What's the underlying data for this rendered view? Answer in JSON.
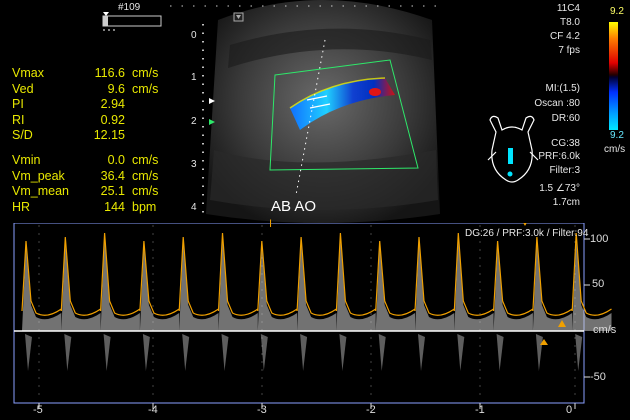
{
  "frame": {
    "number": "#109"
  },
  "settings": {
    "lines": [
      "11C4",
      "T8.0",
      "CF 4.2",
      "7 fps"
    ],
    "mi": "MI:(1.5)",
    "oscan": "Oscan :80",
    "dr": "DR:60",
    "cg": "CG:38",
    "prf": "PRF:6.0k",
    "filter": "Filter:3",
    "angle": "1.5  ∠73°",
    "depth": "1.7cm"
  },
  "color_bar": {
    "top_label": "9.2",
    "bottom_label": "9.2",
    "unit": "cm/s",
    "colors_top": "#ffff00",
    "colors_mid": "#e00000",
    "colors_blue": "#0040ff",
    "colors_bottom": "#00c8ff"
  },
  "measurements": [
    {
      "label": "Vmax",
      "value": "116.6",
      "unit": "cm/s"
    },
    {
      "label": "Ved",
      "value": "9.6",
      "unit": "cm/s"
    },
    {
      "label": "PI",
      "value": "2.94",
      "unit": ""
    },
    {
      "label": "RI",
      "value": "0.92",
      "unit": ""
    },
    {
      "label": "S/D",
      "value": "12.15",
      "unit": ""
    },
    {
      "label": "Vmin",
      "value": "0.0",
      "unit": "cm/s"
    },
    {
      "label": "Vm_peak",
      "value": "36.4",
      "unit": "cm/s"
    },
    {
      "label": "Vm_mean",
      "value": "25.1",
      "unit": "cm/s"
    },
    {
      "label": "HR",
      "value": "144",
      "unit": "bpm"
    }
  ],
  "depth_scale": [
    "0",
    "1",
    "2",
    "3",
    "4"
  ],
  "vessel_label": "AB AO",
  "doppler": {
    "info": "DG:26 /   PRF:3.0k  / Filter:94",
    "velocity_labels": [
      "100",
      "50",
      "cm/s",
      "-50"
    ],
    "time_labels": [
      "-5",
      "-4",
      "-3",
      "-2",
      "-1",
      "0"
    ],
    "cursor_marker": "I"
  }
}
